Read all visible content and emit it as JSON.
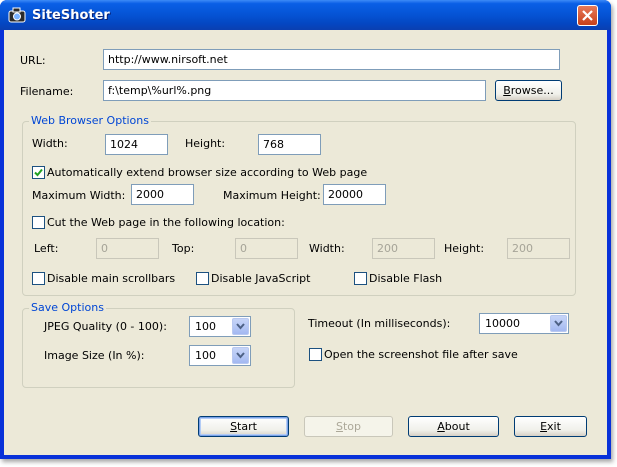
{
  "window": {
    "title": "SiteShoter"
  },
  "url": {
    "label": "URL:",
    "value": "http://www.nirsoft.net"
  },
  "filename": {
    "label": "Filename:",
    "value": "f:\\temp\\%url%.png",
    "browse_label": "Browse..."
  },
  "web_options": {
    "title": "Web Browser Options",
    "width_label": "Width:",
    "width_value": "1024",
    "height_label": "Height:",
    "height_value": "768",
    "auto_extend_label": "Automatically extend browser size according to Web page",
    "auto_extend_checked": true,
    "max_width_label": "Maximum Width:",
    "max_width_value": "2000",
    "max_height_label": "Maximum Height:",
    "max_height_value": "20000",
    "cut_label": "Cut the Web page in the following location:",
    "cut_checked": false,
    "left_label": "Left:",
    "left_value": "0",
    "top_label": "Top:",
    "top_value": "0",
    "cut_width_label": "Width:",
    "cut_width_value": "200",
    "cut_height_label": "Height:",
    "cut_height_value": "200",
    "disable_scrollbars_label": "Disable main scrollbars",
    "disable_js_label": "Disable JavaScript",
    "disable_flash_label": "Disable Flash"
  },
  "save_options": {
    "title": "Save Options",
    "jpeg_label": "JPEG Quality (0 - 100):",
    "jpeg_value": "100",
    "size_label": "Image Size (In %):",
    "size_value": "100"
  },
  "timeout": {
    "label": "Timeout (In milliseconds):",
    "value": "10000"
  },
  "open_after_save_label": "Open the screenshot file after save",
  "buttons": {
    "start": "Start",
    "stop": "Stop",
    "about": "About",
    "exit": "Exit"
  }
}
